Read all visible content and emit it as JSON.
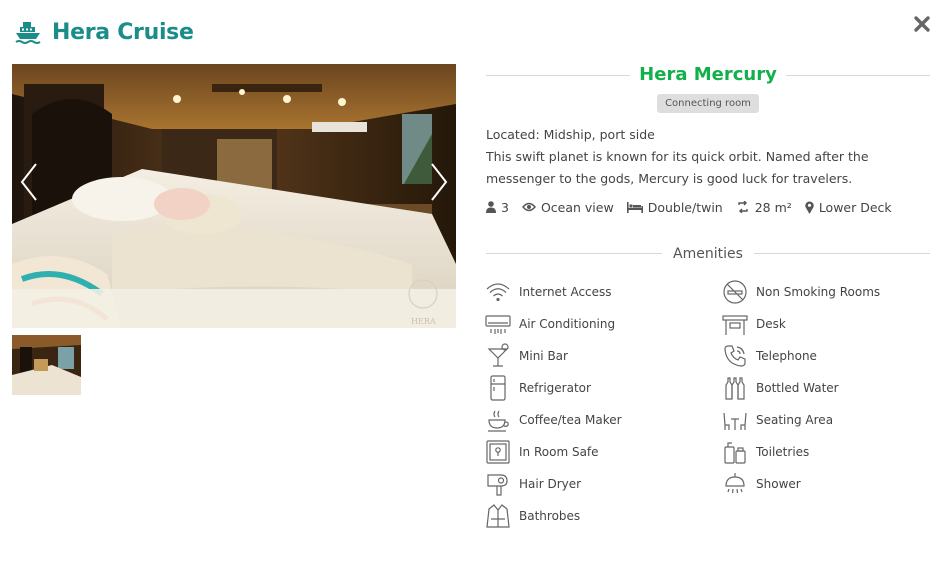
{
  "header": {
    "title": "Hera Cruise",
    "icon": "ship-icon",
    "close_icon": "close-icon"
  },
  "room": {
    "name": "Hera Mercury",
    "badge": "Connecting room",
    "located": "Located: Midship, port side",
    "description": "This swift planet is known for its quick orbit. Named after the messenger to the gods, Mercury is good luck for travelers.",
    "facts": {
      "guests": "3",
      "view": "Ocean view",
      "bed": "Double/twin",
      "size": "28 m²",
      "deck": "Lower Deck"
    }
  },
  "gallery": {
    "prev_icon": "chevron-left-icon",
    "next_icon": "chevron-right-icon",
    "thumbnails": 1,
    "watermark": "HERA"
  },
  "amenities": {
    "title": "Amenities",
    "left": [
      {
        "label": "Internet Access",
        "icon": "wifi-icon"
      },
      {
        "label": "Air Conditioning",
        "icon": "air-conditioner-icon"
      },
      {
        "label": "Mini Bar",
        "icon": "cocktail-icon"
      },
      {
        "label": "Refrigerator",
        "icon": "refrigerator-icon"
      },
      {
        "label": "Coffee/tea Maker",
        "icon": "coffee-cup-icon"
      },
      {
        "label": "In Room Safe",
        "icon": "safe-icon"
      },
      {
        "label": "Hair Dryer",
        "icon": "hair-dryer-icon"
      },
      {
        "label": "Bathrobes",
        "icon": "bathrobe-icon"
      }
    ],
    "right": [
      {
        "label": "Non Smoking Rooms",
        "icon": "no-smoking-icon"
      },
      {
        "label": "Desk",
        "icon": "desk-icon"
      },
      {
        "label": "Telephone",
        "icon": "telephone-icon"
      },
      {
        "label": "Bottled Water",
        "icon": "bottled-water-icon"
      },
      {
        "label": "Seating Area",
        "icon": "seating-area-icon"
      },
      {
        "label": "Toiletries",
        "icon": "toiletries-icon"
      },
      {
        "label": "Shower",
        "icon": "shower-icon"
      }
    ]
  },
  "colors": {
    "brand": "#1a8c8a",
    "room_name": "#12b04a",
    "badge_bg": "#dedede"
  }
}
